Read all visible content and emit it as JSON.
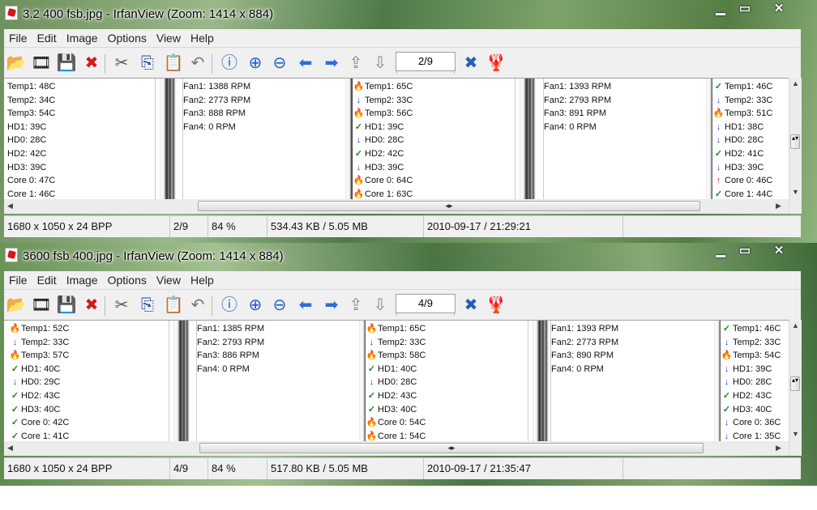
{
  "windows": [
    {
      "title": "3.2 400 fsb.jpg - IrfanView (Zoom: 1414 x 884)",
      "menu": [
        "File",
        "Edit",
        "Image",
        "Options",
        "View",
        "Help"
      ],
      "page": "2/9",
      "status": [
        "1680 x 1050 x 24 BPP",
        "2/9",
        "84 %",
        "534.43 KB / 5.05 MB",
        "2010-09-17 / 21:29:21"
      ],
      "cols": [
        {
          "icons": false,
          "rows": [
            {
              "label": "Temp1:",
              "value": "48C"
            },
            {
              "label": "Temp2:",
              "value": "34C"
            },
            {
              "label": "Temp3:",
              "value": "54C"
            },
            {
              "label": "HD1:",
              "value": "39C"
            },
            {
              "label": "HD0:",
              "value": "28C"
            },
            {
              "label": "HD2:",
              "value": "42C"
            },
            {
              "label": "HD3:",
              "value": "39C"
            },
            {
              "label": "Core 0:",
              "value": "47C"
            },
            {
              "label": "Core 1:",
              "value": "46C"
            }
          ]
        },
        {
          "icons": false,
          "rows": [
            {
              "label": "Fan1:",
              "value": "1388 RPM"
            },
            {
              "label": "Fan2:",
              "value": "2773 RPM"
            },
            {
              "label": "Fan3:",
              "value": "888 RPM"
            },
            {
              "label": "Fan4:",
              "value": "0 RPM"
            }
          ]
        },
        {
          "icons": true,
          "rows": [
            {
              "icon": "fire",
              "label": "Temp1:",
              "value": "65C"
            },
            {
              "icon": "down",
              "label": "Temp2:",
              "value": "33C"
            },
            {
              "icon": "fire",
              "label": "Temp3:",
              "value": "56C"
            },
            {
              "icon": "check",
              "label": "HD1:",
              "value": "39C"
            },
            {
              "icon": "down",
              "label": "HD0:",
              "value": "28C"
            },
            {
              "icon": "check",
              "label": "HD2:",
              "value": "42C"
            },
            {
              "icon": "down",
              "label": "HD3:",
              "value": "39C"
            },
            {
              "icon": "fire",
              "label": "Core 0:",
              "value": "64C"
            },
            {
              "icon": "fire",
              "label": "Core 1:",
              "value": "63C"
            }
          ]
        },
        {
          "icons": false,
          "rows": [
            {
              "label": "Fan1:",
              "value": "1393 RPM"
            },
            {
              "label": "Fan2:",
              "value": "2793 RPM"
            },
            {
              "label": "Fan3:",
              "value": "891 RPM"
            },
            {
              "label": "Fan4:",
              "value": "0 RPM"
            }
          ]
        },
        {
          "icons": true,
          "rows": [
            {
              "icon": "check",
              "label": "Temp1:",
              "value": "46C"
            },
            {
              "icon": "down",
              "label": "Temp2:",
              "value": "33C"
            },
            {
              "icon": "fire",
              "label": "Temp3:",
              "value": "51C"
            },
            {
              "icon": "down",
              "label": "HD1:",
              "value": "38C"
            },
            {
              "icon": "down",
              "label": "HD0:",
              "value": "28C"
            },
            {
              "icon": "check",
              "label": "HD2:",
              "value": "41C"
            },
            {
              "icon": "down",
              "label": "HD3:",
              "value": "39C"
            },
            {
              "icon": "up",
              "label": "Core 0:",
              "value": "46C"
            },
            {
              "icon": "check",
              "label": "Core 1:",
              "value": "44C"
            }
          ]
        }
      ]
    },
    {
      "title": "3600 fsb 400.jpg - IrfanView (Zoom: 1414 x 884)",
      "menu": [
        "File",
        "Edit",
        "Image",
        "Options",
        "View",
        "Help"
      ],
      "page": "4/9",
      "status": [
        "1680 x 1050 x 24 BPP",
        "4/9",
        "84 %",
        "517.80 KB / 5.05 MB",
        "2010-09-17 / 21:35:47"
      ],
      "cols": [
        {
          "icons": true,
          "rows": [
            {
              "icon": "fire",
              "label": "Temp1:",
              "value": "52C"
            },
            {
              "icon": "down",
              "label": "Temp2:",
              "value": "33C"
            },
            {
              "icon": "fire",
              "label": "Temp3:",
              "value": "57C"
            },
            {
              "icon": "check",
              "label": "HD1:",
              "value": "40C"
            },
            {
              "icon": "down",
              "label": "HD0:",
              "value": "29C"
            },
            {
              "icon": "check",
              "label": "HD2:",
              "value": "43C"
            },
            {
              "icon": "check",
              "label": "HD3:",
              "value": "40C"
            },
            {
              "icon": "check",
              "label": "Core 0:",
              "value": "42C"
            },
            {
              "icon": "check",
              "label": "Core 1:",
              "value": "41C"
            }
          ]
        },
        {
          "icons": false,
          "rows": [
            {
              "label": "Fan1:",
              "value": "1385 RPM"
            },
            {
              "label": "Fan2:",
              "value": "2793 RPM"
            },
            {
              "label": "Fan3:",
              "value": "886 RPM"
            },
            {
              "label": "Fan4:",
              "value": "0 RPM"
            }
          ]
        },
        {
          "icons": true,
          "rows": [
            {
              "icon": "fire",
              "label": "Temp1:",
              "value": "65C"
            },
            {
              "icon": "down",
              "label": "Temp2:",
              "value": "33C"
            },
            {
              "icon": "fire",
              "label": "Temp3:",
              "value": "58C"
            },
            {
              "icon": "check",
              "label": "HD1:",
              "value": "40C"
            },
            {
              "icon": "down",
              "label": "HD0:",
              "value": "28C"
            },
            {
              "icon": "check",
              "label": "HD2:",
              "value": "43C"
            },
            {
              "icon": "check",
              "label": "HD3:",
              "value": "40C"
            },
            {
              "icon": "fire",
              "label": "Core 0:",
              "value": "54C"
            },
            {
              "icon": "fire",
              "label": "Core 1:",
              "value": "54C"
            }
          ]
        },
        {
          "icons": false,
          "rows": [
            {
              "label": "Fan1:",
              "value": "1393 RPM"
            },
            {
              "label": "Fan2:",
              "value": "2773 RPM"
            },
            {
              "label": "Fan3:",
              "value": "890 RPM"
            },
            {
              "label": "Fan4:",
              "value": "0 RPM"
            }
          ]
        },
        {
          "icons": true,
          "rows": [
            {
              "icon": "check",
              "label": "Temp1:",
              "value": "46C"
            },
            {
              "icon": "down",
              "label": "Temp2:",
              "value": "33C"
            },
            {
              "icon": "fire",
              "label": "Temp3:",
              "value": "54C"
            },
            {
              "icon": "down",
              "label": "HD1:",
              "value": "39C"
            },
            {
              "icon": "down",
              "label": "HD0:",
              "value": "28C"
            },
            {
              "icon": "check",
              "label": "HD2:",
              "value": "43C"
            },
            {
              "icon": "check",
              "label": "HD3:",
              "value": "40C"
            },
            {
              "icon": "down",
              "label": "Core 0:",
              "value": "36C"
            },
            {
              "icon": "down",
              "label": "Core 1:",
              "value": "35C"
            }
          ]
        }
      ]
    }
  ],
  "icons": {
    "fire": "🔥",
    "down": "↓",
    "check": "✓",
    "up": "↑"
  },
  "toolbar_icons": [
    "open-folder-icon",
    "slideshow-icon",
    "save-icon",
    "delete-icon",
    "cut-icon",
    "copy-icon",
    "paste-icon",
    "undo-icon",
    "info-icon",
    "zoom-in-icon",
    "zoom-out-icon",
    "previous-icon",
    "next-icon",
    "page-up-icon",
    "page-down-icon",
    "page-number",
    "settings-icon",
    "irfanview-logo-icon"
  ]
}
